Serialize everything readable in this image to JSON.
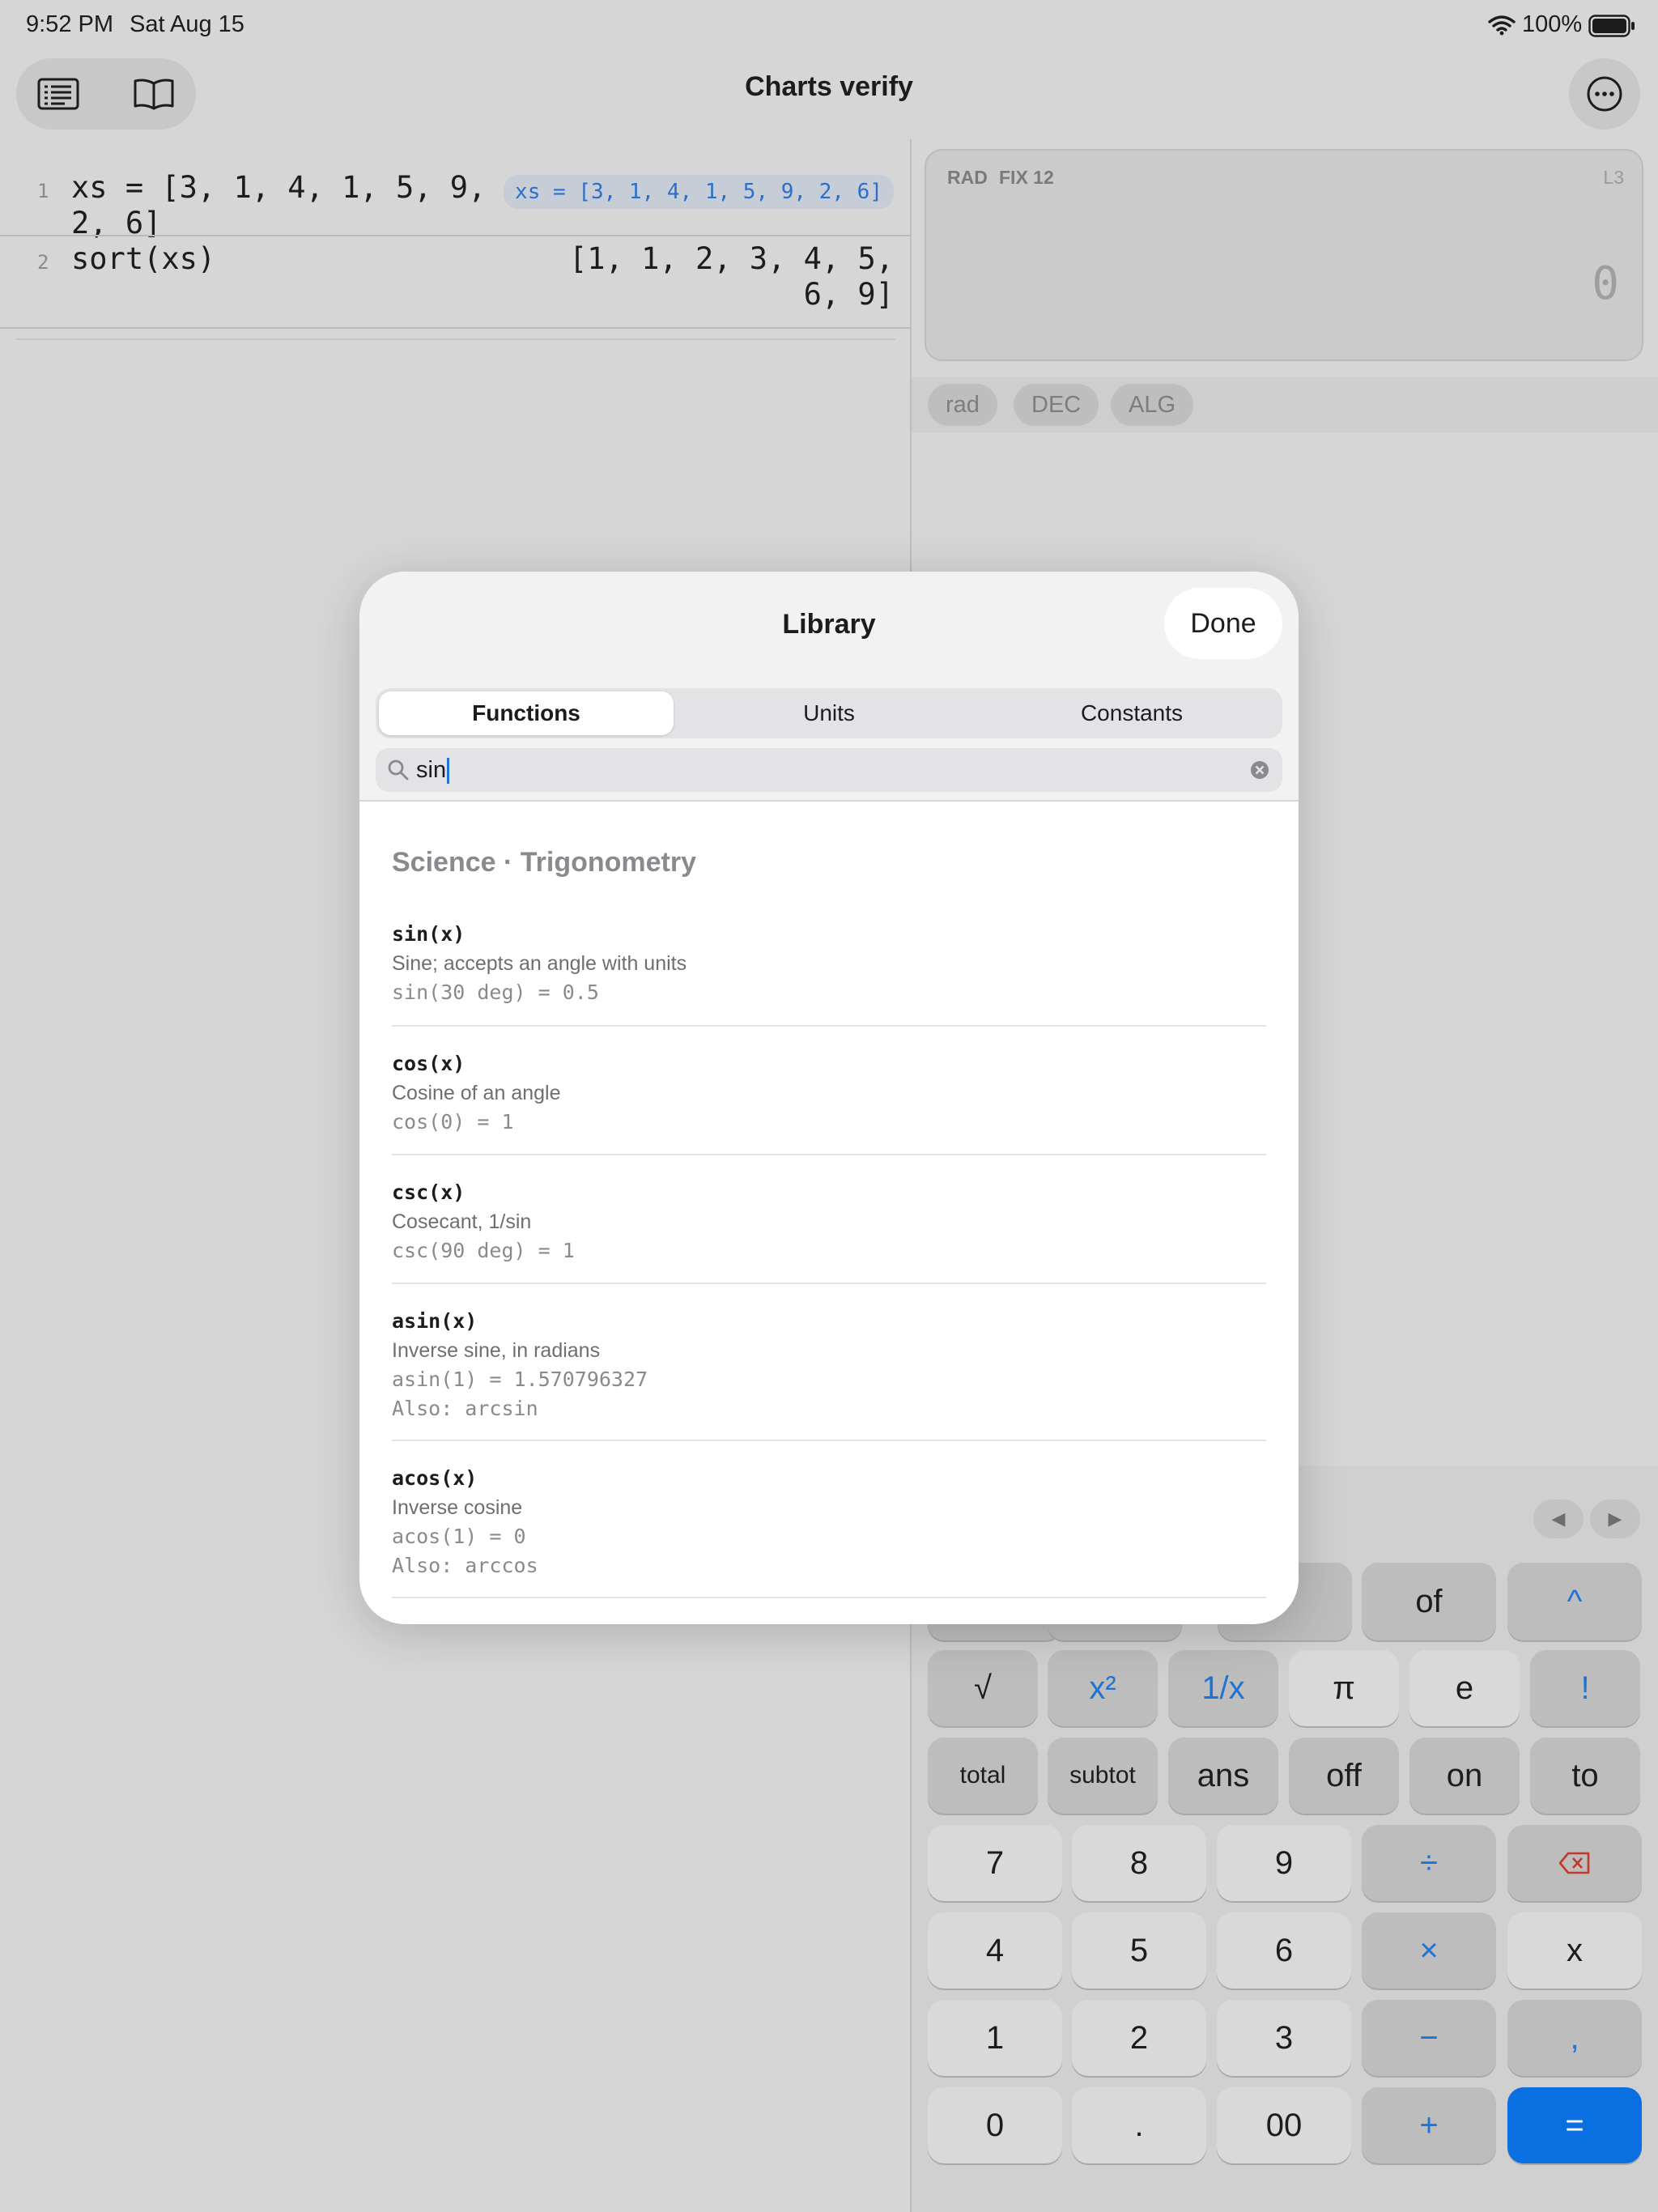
{
  "status_bar": {
    "time": "9:52 PM",
    "date": "Sat Aug 15",
    "battery": "100%"
  },
  "toolbar": {
    "title": "Charts verify"
  },
  "editor": {
    "lines": [
      {
        "number": "1",
        "code": "xs = [3, 1, 4, 1, 5, 9,\n2, 6]",
        "result": "xs = [3, 1, 4, 1, 5, 9, 2, 6]"
      },
      {
        "number": "2",
        "code": "sort(xs)",
        "result": "[1, 1, 2, 3, 4, 5,\n6, 9]"
      }
    ]
  },
  "calculator": {
    "display": {
      "angle_mode": "RAD",
      "format": "FIX 12",
      "line_ref": "L3",
      "value": "0"
    },
    "chips": [
      "rad",
      "DEC",
      "ALG"
    ],
    "keys": {
      "row0": [
        "of",
        "^"
      ],
      "row1": [
        "√",
        "x²",
        "1/x",
        "π",
        "e",
        "!"
      ],
      "row2": [
        "total",
        "subtot",
        "ans",
        "off",
        "on",
        "to"
      ],
      "row3": [
        "7",
        "8",
        "9",
        "÷",
        "⌫"
      ],
      "row4": [
        "4",
        "5",
        "6",
        "×",
        "x"
      ],
      "row5": [
        "1",
        "2",
        "3",
        "−",
        ","
      ],
      "row6": [
        "0",
        ".",
        "00",
        "+",
        "="
      ]
    },
    "cursor_left": "◀",
    "cursor_right": "▶"
  },
  "library": {
    "title": "Library",
    "done_label": "Done",
    "tabs": [
      "Functions",
      "Units",
      "Constants"
    ],
    "active_tab": "Functions",
    "search": {
      "value": "sin"
    },
    "section": "Science · Trigonometry",
    "items": [
      {
        "signature": "sin(x)",
        "description": "Sine; accepts an angle with units",
        "example": "sin(30 deg) = 0.5",
        "also": ""
      },
      {
        "signature": "cos(x)",
        "description": "Cosine of an angle",
        "example": "cos(0) = 1",
        "also": ""
      },
      {
        "signature": "csc(x)",
        "description": "Cosecant, 1/sin",
        "example": "csc(90 deg) = 1",
        "also": ""
      },
      {
        "signature": "asin(x)",
        "description": "Inverse sine, in radians",
        "example": "asin(1) = 1.570796327",
        "also": "Also: arcsin"
      },
      {
        "signature": "acos(x)",
        "description": "Inverse cosine",
        "example": "acos(1) = 0",
        "also": "Also: arccos"
      }
    ]
  },
  "colors": {
    "accent": "#1e73d6",
    "equals_key": "#0a6fe0",
    "backdrop": "#d6d6d6"
  },
  "icons": {
    "wifi": "wifi-icon",
    "battery": "battery-icon",
    "sidebar": "list-icon",
    "library": "book-icon",
    "more": "ellipsis-circle-icon",
    "search": "search-icon",
    "clear": "clear-icon",
    "backspace": "backspace-icon"
  }
}
